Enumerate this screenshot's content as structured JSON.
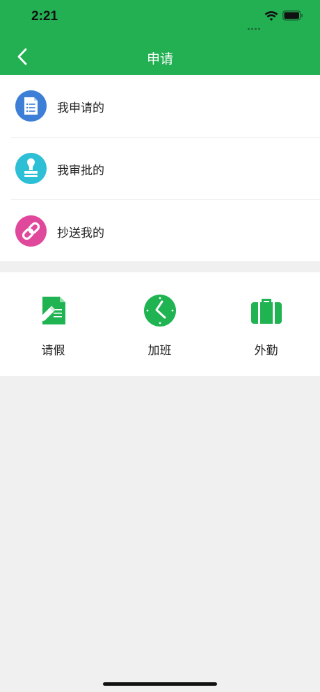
{
  "status_bar": {
    "time": "2:21"
  },
  "nav": {
    "title": "申请"
  },
  "list": {
    "items": [
      {
        "label": "我申请的",
        "icon": "document-icon",
        "color": "#3d7fd6"
      },
      {
        "label": "我审批的",
        "icon": "stamp-icon",
        "color": "#2cbfd6"
      },
      {
        "label": "抄送我的",
        "icon": "link-icon",
        "color": "#e0489c"
      }
    ]
  },
  "grid": {
    "items": [
      {
        "label": "请假",
        "icon": "leave-note-icon"
      },
      {
        "label": "加班",
        "icon": "clock-icon"
      },
      {
        "label": "外勤",
        "icon": "briefcase-icon"
      }
    ]
  },
  "colors": {
    "brand_green": "#22b052",
    "icon_green": "#1fb352",
    "background": "#f0f0f0"
  }
}
